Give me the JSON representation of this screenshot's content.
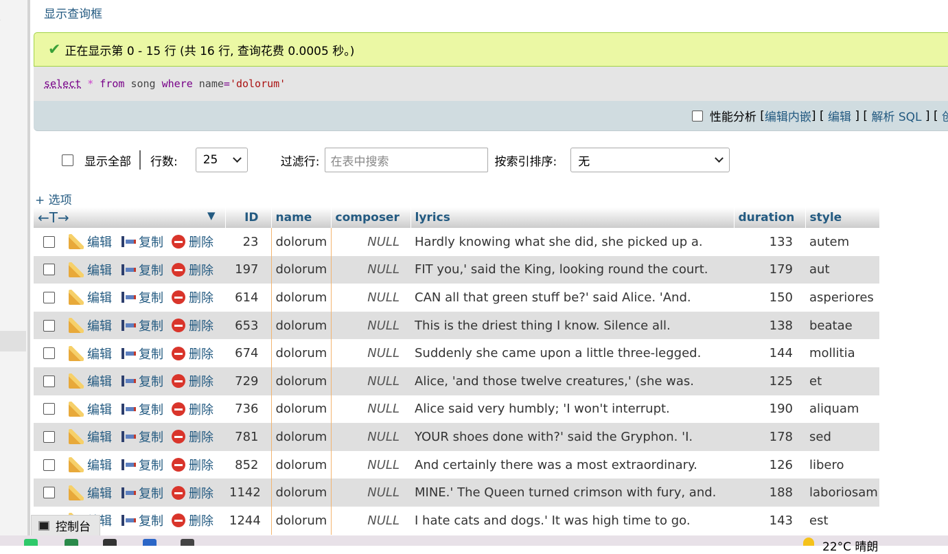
{
  "toggle_query_box": "显示查询框",
  "success": {
    "message": "正在显示第 0 - 15 行 (共 16 行, 查询花费 0.0005 秒。)"
  },
  "sql": {
    "select": "select",
    "star": "*",
    "from": "from",
    "table": "song",
    "where": "where",
    "column": "name",
    "operator": "=",
    "value": "'dolorum'"
  },
  "tools": {
    "profiling": "性能分析",
    "edit_inline": "编辑内嵌",
    "edit": "编辑",
    "explain": "解析 SQL",
    "create_cut": "创"
  },
  "nav": {
    "show_all": "显示全部",
    "rows_label": "行数:",
    "rows_value": "25",
    "filter_label": "过滤行:",
    "filter_placeholder": "在表中搜索",
    "sort_label": "按索引排序:",
    "sort_value": "无"
  },
  "options_link": "+ 选项",
  "table": {
    "columns": [
      "ID",
      "name",
      "composer",
      "lyrics",
      "duration",
      "style"
    ],
    "action_labels": {
      "edit": "编辑",
      "copy": "复制",
      "delete": "删除"
    },
    "rows": [
      {
        "id": "23",
        "name": "dolorum",
        "composer": "NULL",
        "lyrics": "Hardly knowing what she did, she picked up a.",
        "duration": "133",
        "style": "autem"
      },
      {
        "id": "197",
        "name": "dolorum",
        "composer": "NULL",
        "lyrics": "FIT you,' said the King, looking round the court.",
        "duration": "179",
        "style": "aut"
      },
      {
        "id": "614",
        "name": "dolorum",
        "composer": "NULL",
        "lyrics": "CAN all that green stuff be?' said Alice. 'And.",
        "duration": "150",
        "style": "asperiores"
      },
      {
        "id": "653",
        "name": "dolorum",
        "composer": "NULL",
        "lyrics": "This is the driest thing I know. Silence all.",
        "duration": "138",
        "style": "beatae"
      },
      {
        "id": "674",
        "name": "dolorum",
        "composer": "NULL",
        "lyrics": "Suddenly she came upon a little three-legged.",
        "duration": "144",
        "style": "mollitia"
      },
      {
        "id": "729",
        "name": "dolorum",
        "composer": "NULL",
        "lyrics": "Alice, 'and those twelve creatures,' (she was.",
        "duration": "125",
        "style": "et"
      },
      {
        "id": "736",
        "name": "dolorum",
        "composer": "NULL",
        "lyrics": "Alice said very humbly; 'I won't interrupt.",
        "duration": "190",
        "style": "aliquam"
      },
      {
        "id": "781",
        "name": "dolorum",
        "composer": "NULL",
        "lyrics": "YOUR shoes done with?' said the Gryphon. 'I.",
        "duration": "178",
        "style": "sed"
      },
      {
        "id": "852",
        "name": "dolorum",
        "composer": "NULL",
        "lyrics": "And certainly there was a most extraordinary.",
        "duration": "126",
        "style": "libero"
      },
      {
        "id": "1142",
        "name": "dolorum",
        "composer": "NULL",
        "lyrics": "MINE.' The Queen turned crimson with fury, and.",
        "duration": "188",
        "style": "laboriosam"
      },
      {
        "id": "1244",
        "name": "dolorum",
        "composer": "NULL",
        "lyrics": "I hate cats and dogs.' It was high time to go.",
        "duration": "143",
        "style": "est"
      }
    ]
  },
  "console": {
    "label": "控制台"
  },
  "taskbar": {
    "weather": "22°C  晴朗"
  },
  "colors": {
    "link": "#235a81",
    "success_bg": "#ebf8a4",
    "row_alt": "#dfdfdf",
    "accent_border": "#f2b46f"
  }
}
